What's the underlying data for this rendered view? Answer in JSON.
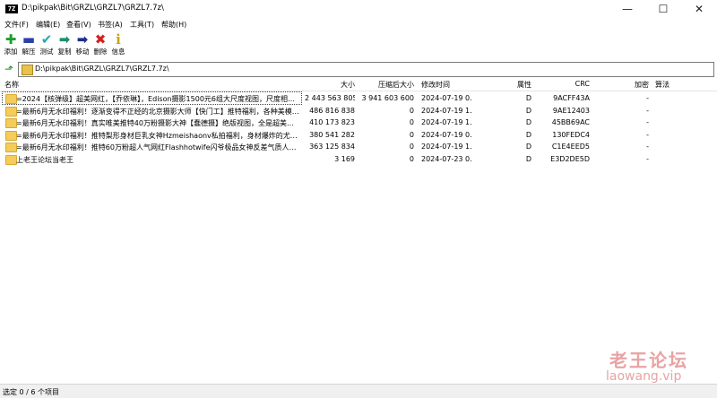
{
  "window": {
    "icon_text": "7Z",
    "title": "D:\\pikpak\\Bit\\GRZL\\GRZL7\\GRZL7.7z\\",
    "minimize_glyph": "—",
    "maximize_glyph": "☐",
    "close_glyph": "✕"
  },
  "menu": [
    "文件(F)",
    "编辑(E)",
    "查看(V)",
    "书签(A)",
    "工具(T)",
    "帮助(H)"
  ],
  "toolbar": [
    {
      "label": "添加",
      "glyph": "✚",
      "color": "#1e9e2a",
      "icon": "add-icon"
    },
    {
      "label": "解压",
      "glyph": "▬",
      "color": "#2a3fa8",
      "icon": "extract-icon"
    },
    {
      "label": "测试",
      "glyph": "✔",
      "color": "#2aa6b0",
      "icon": "test-icon"
    },
    {
      "label": "复制",
      "glyph": "➡",
      "color": "#1e8e6a",
      "icon": "copy-icon"
    },
    {
      "label": "移动",
      "glyph": "➡",
      "color": "#1f2f8a",
      "icon": "move-icon"
    },
    {
      "label": "删除",
      "glyph": "✖",
      "color": "#d42020",
      "icon": "delete-icon"
    },
    {
      "label": "信息",
      "glyph": "i",
      "color": "#c9a600",
      "icon": "info-icon"
    }
  ],
  "address": {
    "path": "D:\\pikpak\\Bit\\GRZL\\GRZL7\\GRZL7.7z\\"
  },
  "columns": {
    "name": "名称",
    "size": "大小",
    "packed": "压缩后大小",
    "modified": "修改时间",
    "attr": "属性",
    "crc": "CRC",
    "encrypted": "加密",
    "method": "算法"
  },
  "rows": [
    {
      "name": "=2024【核弹级】超美网红，【乔依琳】，Edison摄影1500元6组大尺度视图，尺度相当...",
      "size": "2 443 563 805",
      "packed": "3 941 603 600",
      "modified": "2024-07-19 0...",
      "attr": "D",
      "crc": "9ACFF43A",
      "encrypted": "-",
      "method": ""
    },
    {
      "name": "=最新6月无水印福利！逐渐变得不正经的北京摄影大师【快门工】推特福利，各种美模露...",
      "size": "486 816 838",
      "packed": "0",
      "modified": "2024-07-19 1...",
      "attr": "D",
      "crc": "9AE12403",
      "encrypted": "-",
      "method": ""
    },
    {
      "name": "=最新6月无水印福利！真实唯美推特40万粉摄影大神【蠢德摄】绝版视图，全是超美模特...",
      "size": "410 173 823",
      "packed": "0",
      "modified": "2024-07-19 1...",
      "attr": "D",
      "crc": "45BB69AC",
      "encrypted": "-",
      "method": ""
    },
    {
      "name": "=最新6月无水印福利！推特梨形身材巨乳女神Hzmeishaonv私拍福利，身材爆炸的尤物。...",
      "size": "380 541 282",
      "packed": "0",
      "modified": "2024-07-19 0...",
      "attr": "D",
      "crc": "130FEDC4",
      "encrypted": "-",
      "method": ""
    },
    {
      "name": "=最新6月无水印福利！推特60万粉超人气网红Flashhotwife闪爷极品女神反差气质人妻赛...",
      "size": "363 125 834",
      "packed": "0",
      "modified": "2024-07-19 1...",
      "attr": "D",
      "crc": "C1E4EED5",
      "encrypted": "-",
      "method": ""
    },
    {
      "name": "上老王论坛当老王",
      "size": "3 169",
      "packed": "0",
      "modified": "2024-07-23 0...",
      "attr": "D",
      "crc": "E3D2DE5D",
      "encrypted": "-",
      "method": ""
    }
  ],
  "status": {
    "text": "选定 0 / 6 个项目"
  },
  "watermark": {
    "line1": "老王论坛",
    "line2": "laowang.vip"
  }
}
